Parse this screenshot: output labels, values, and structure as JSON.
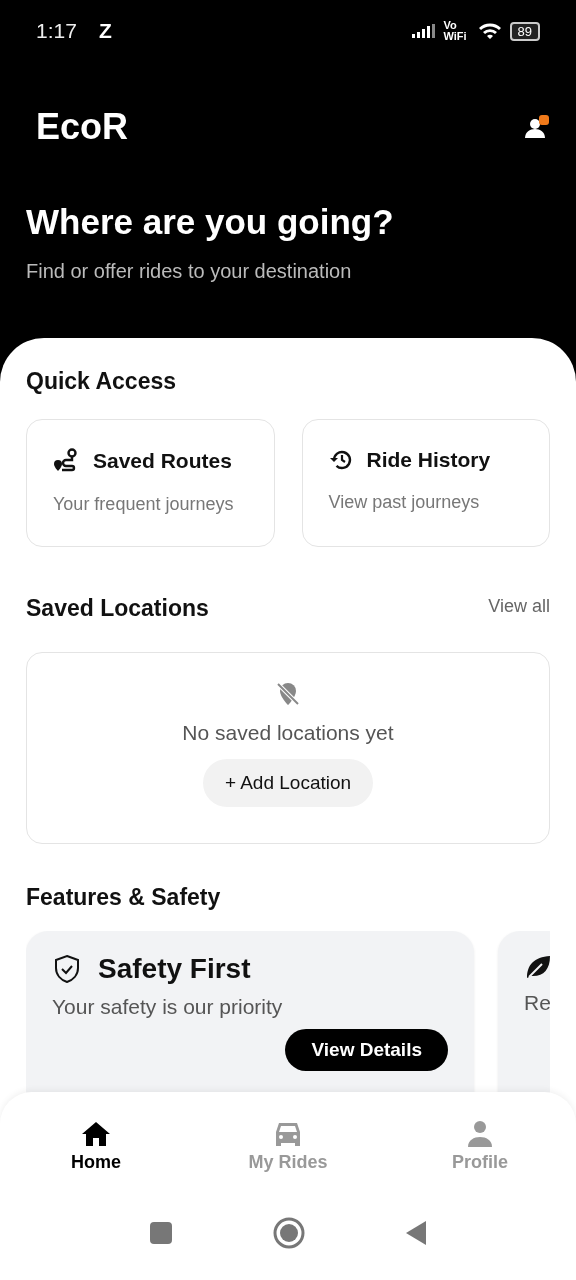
{
  "status_bar": {
    "time": "1:17",
    "notification": "Z",
    "network_label": "Vo WiFi",
    "battery": "89"
  },
  "header": {
    "app_name": "EcoR",
    "headline": "Where are you going?",
    "subtitle": "Find or offer rides to your destination"
  },
  "quick_access": {
    "title": "Quick Access",
    "cards": [
      {
        "kind": "routes",
        "title": "Saved Routes",
        "subtitle": "Your frequent journeys"
      },
      {
        "kind": "history",
        "title": "Ride History",
        "subtitle": "View past journeys"
      }
    ]
  },
  "saved_locations": {
    "title": "Saved Locations",
    "link": "View all",
    "empty_text": "No saved locations yet",
    "add_button": "+ Add Location"
  },
  "features": {
    "title": "Features & Safety",
    "cards": [
      {
        "kind": "shield",
        "title": "Safety First",
        "subtitle": "Your safety is our priority",
        "button": "View Details"
      },
      {
        "kind": "leaf",
        "subtitle": "Re"
      }
    ]
  },
  "bottom_nav": [
    {
      "kind": "home",
      "label": "Home",
      "selected": true
    },
    {
      "kind": "car",
      "label": "My Rides",
      "selected": false
    },
    {
      "kind": "person",
      "label": "Profile",
      "selected": false
    }
  ]
}
